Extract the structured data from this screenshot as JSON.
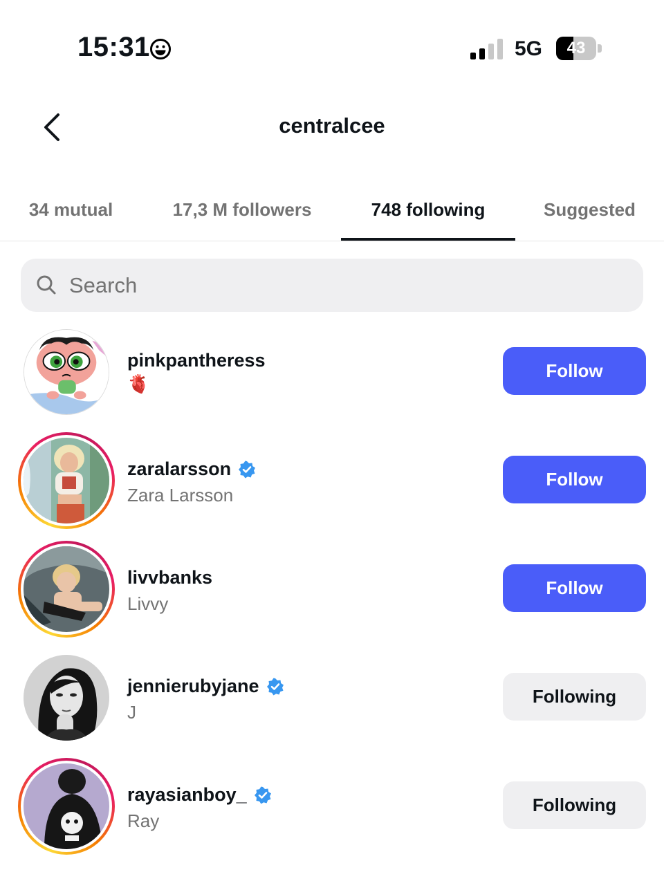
{
  "status_bar": {
    "time": "15:31",
    "emoji_icon": "grinning-face-icon",
    "network": "5G",
    "battery_percent": "43",
    "battery_level": 0.43
  },
  "header": {
    "back_icon": "chevron-left-icon",
    "title": "centralcee"
  },
  "tabs": [
    {
      "label": "34 mutual",
      "active": false
    },
    {
      "label": "17,3 M followers",
      "active": false
    },
    {
      "label": "748 following",
      "active": true
    },
    {
      "label": "Suggested",
      "active": false
    }
  ],
  "search": {
    "placeholder": "Search",
    "value": "",
    "icon": "search-icon"
  },
  "accounts": [
    {
      "username": "pinkpantheress",
      "subtitle": "🫀",
      "verified": false,
      "story_ring": false,
      "button": "Follow",
      "avatar_icon": "powerpuff-cartoon-avatar"
    },
    {
      "username": "zaralarsson",
      "subtitle": "Zara Larsson",
      "verified": true,
      "story_ring": true,
      "button": "Follow",
      "avatar_icon": "photo-avatar"
    },
    {
      "username": "livvbanks",
      "subtitle": "Livvy",
      "verified": false,
      "story_ring": true,
      "button": "Follow",
      "avatar_icon": "photo-avatar"
    },
    {
      "username": "jennierubyjane",
      "subtitle": "J",
      "verified": true,
      "story_ring": false,
      "button": "Following",
      "avatar_icon": "bw-photo-avatar"
    },
    {
      "username": "rayasianboy_",
      "subtitle": "Ray",
      "verified": true,
      "story_ring": true,
      "button": "Following",
      "avatar_icon": "photo-avatar"
    }
  ],
  "colors": {
    "follow_button": "#4a5df9",
    "following_button": "#efeff1",
    "verified_badge": "#3897f0",
    "secondary_text": "#737373"
  }
}
